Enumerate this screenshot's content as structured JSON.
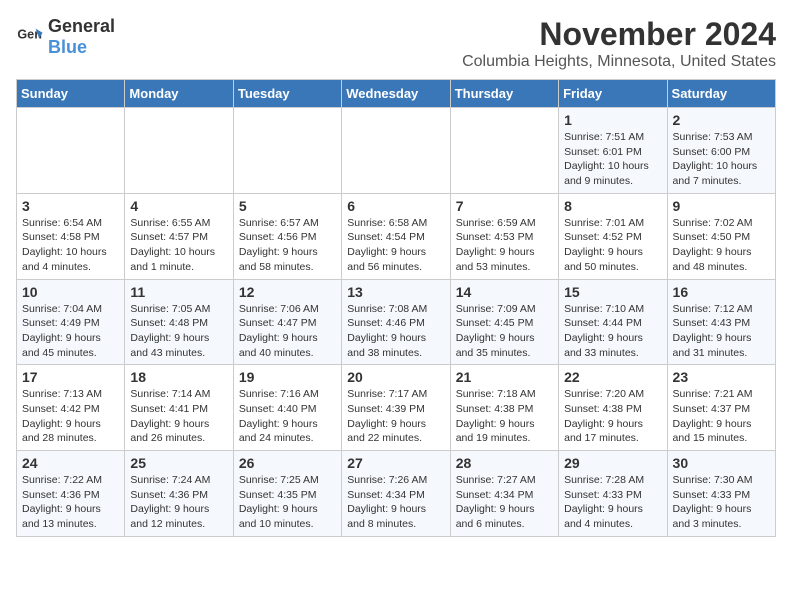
{
  "header": {
    "logo_general": "General",
    "logo_blue": "Blue",
    "title": "November 2024",
    "subtitle": "Columbia Heights, Minnesota, United States"
  },
  "calendar": {
    "days_of_week": [
      "Sunday",
      "Monday",
      "Tuesday",
      "Wednesday",
      "Thursday",
      "Friday",
      "Saturday"
    ],
    "weeks": [
      [
        {
          "day": "",
          "info": ""
        },
        {
          "day": "",
          "info": ""
        },
        {
          "day": "",
          "info": ""
        },
        {
          "day": "",
          "info": ""
        },
        {
          "day": "",
          "info": ""
        },
        {
          "day": "1",
          "info": "Sunrise: 7:51 AM\nSunset: 6:01 PM\nDaylight: 10 hours and 9 minutes."
        },
        {
          "day": "2",
          "info": "Sunrise: 7:53 AM\nSunset: 6:00 PM\nDaylight: 10 hours and 7 minutes."
        }
      ],
      [
        {
          "day": "3",
          "info": "Sunrise: 6:54 AM\nSunset: 4:58 PM\nDaylight: 10 hours and 4 minutes."
        },
        {
          "day": "4",
          "info": "Sunrise: 6:55 AM\nSunset: 4:57 PM\nDaylight: 10 hours and 1 minute."
        },
        {
          "day": "5",
          "info": "Sunrise: 6:57 AM\nSunset: 4:56 PM\nDaylight: 9 hours and 58 minutes."
        },
        {
          "day": "6",
          "info": "Sunrise: 6:58 AM\nSunset: 4:54 PM\nDaylight: 9 hours and 56 minutes."
        },
        {
          "day": "7",
          "info": "Sunrise: 6:59 AM\nSunset: 4:53 PM\nDaylight: 9 hours and 53 minutes."
        },
        {
          "day": "8",
          "info": "Sunrise: 7:01 AM\nSunset: 4:52 PM\nDaylight: 9 hours and 50 minutes."
        },
        {
          "day": "9",
          "info": "Sunrise: 7:02 AM\nSunset: 4:50 PM\nDaylight: 9 hours and 48 minutes."
        }
      ],
      [
        {
          "day": "10",
          "info": "Sunrise: 7:04 AM\nSunset: 4:49 PM\nDaylight: 9 hours and 45 minutes."
        },
        {
          "day": "11",
          "info": "Sunrise: 7:05 AM\nSunset: 4:48 PM\nDaylight: 9 hours and 43 minutes."
        },
        {
          "day": "12",
          "info": "Sunrise: 7:06 AM\nSunset: 4:47 PM\nDaylight: 9 hours and 40 minutes."
        },
        {
          "day": "13",
          "info": "Sunrise: 7:08 AM\nSunset: 4:46 PM\nDaylight: 9 hours and 38 minutes."
        },
        {
          "day": "14",
          "info": "Sunrise: 7:09 AM\nSunset: 4:45 PM\nDaylight: 9 hours and 35 minutes."
        },
        {
          "day": "15",
          "info": "Sunrise: 7:10 AM\nSunset: 4:44 PM\nDaylight: 9 hours and 33 minutes."
        },
        {
          "day": "16",
          "info": "Sunrise: 7:12 AM\nSunset: 4:43 PM\nDaylight: 9 hours and 31 minutes."
        }
      ],
      [
        {
          "day": "17",
          "info": "Sunrise: 7:13 AM\nSunset: 4:42 PM\nDaylight: 9 hours and 28 minutes."
        },
        {
          "day": "18",
          "info": "Sunrise: 7:14 AM\nSunset: 4:41 PM\nDaylight: 9 hours and 26 minutes."
        },
        {
          "day": "19",
          "info": "Sunrise: 7:16 AM\nSunset: 4:40 PM\nDaylight: 9 hours and 24 minutes."
        },
        {
          "day": "20",
          "info": "Sunrise: 7:17 AM\nSunset: 4:39 PM\nDaylight: 9 hours and 22 minutes."
        },
        {
          "day": "21",
          "info": "Sunrise: 7:18 AM\nSunset: 4:38 PM\nDaylight: 9 hours and 19 minutes."
        },
        {
          "day": "22",
          "info": "Sunrise: 7:20 AM\nSunset: 4:38 PM\nDaylight: 9 hours and 17 minutes."
        },
        {
          "day": "23",
          "info": "Sunrise: 7:21 AM\nSunset: 4:37 PM\nDaylight: 9 hours and 15 minutes."
        }
      ],
      [
        {
          "day": "24",
          "info": "Sunrise: 7:22 AM\nSunset: 4:36 PM\nDaylight: 9 hours and 13 minutes."
        },
        {
          "day": "25",
          "info": "Sunrise: 7:24 AM\nSunset: 4:36 PM\nDaylight: 9 hours and 12 minutes."
        },
        {
          "day": "26",
          "info": "Sunrise: 7:25 AM\nSunset: 4:35 PM\nDaylight: 9 hours and 10 minutes."
        },
        {
          "day": "27",
          "info": "Sunrise: 7:26 AM\nSunset: 4:34 PM\nDaylight: 9 hours and 8 minutes."
        },
        {
          "day": "28",
          "info": "Sunrise: 7:27 AM\nSunset: 4:34 PM\nDaylight: 9 hours and 6 minutes."
        },
        {
          "day": "29",
          "info": "Sunrise: 7:28 AM\nSunset: 4:33 PM\nDaylight: 9 hours and 4 minutes."
        },
        {
          "day": "30",
          "info": "Sunrise: 7:30 AM\nSunset: 4:33 PM\nDaylight: 9 hours and 3 minutes."
        }
      ]
    ]
  }
}
